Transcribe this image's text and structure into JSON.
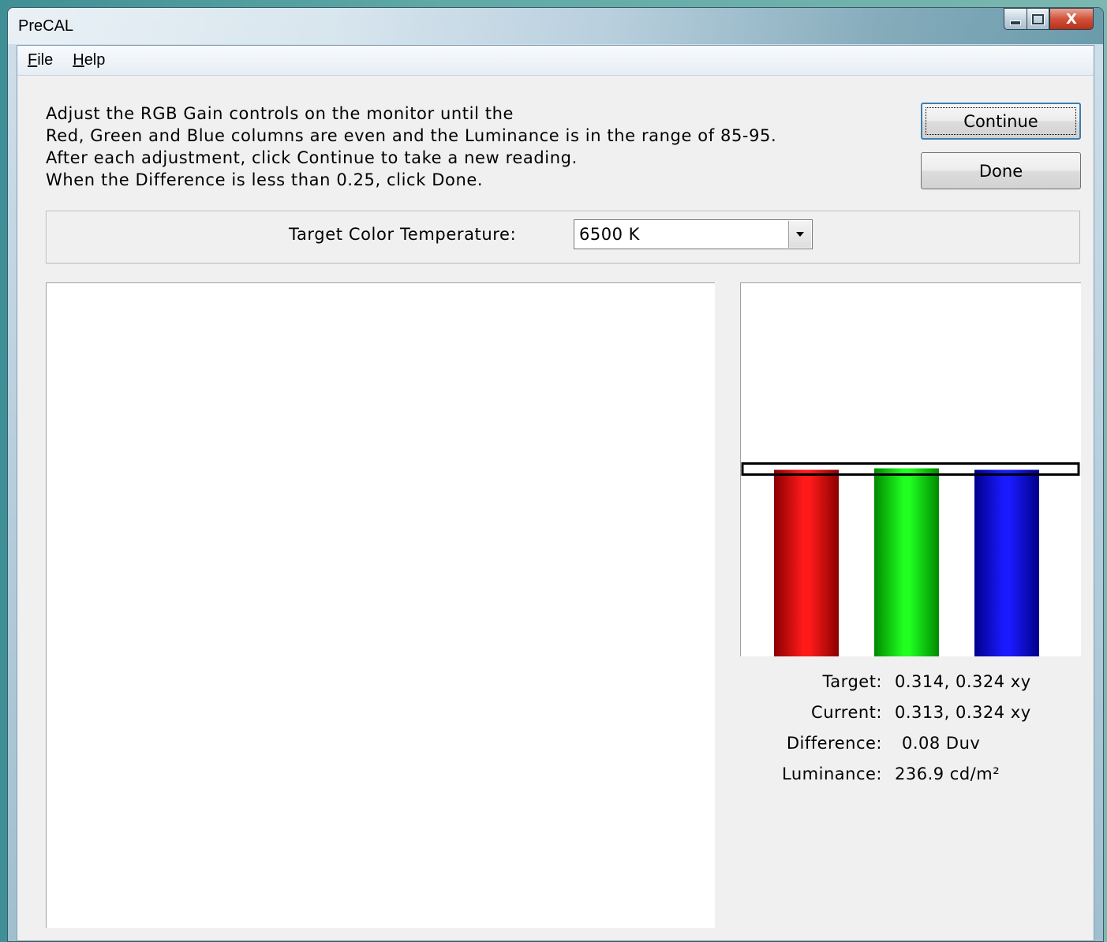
{
  "window": {
    "title": "PreCAL",
    "close_glyph": "X"
  },
  "menu": {
    "file": {
      "accel": "F",
      "rest": "ile"
    },
    "help": {
      "accel": "H",
      "rest": "elp"
    }
  },
  "instructions": [
    "Adjust the RGB Gain controls on the monitor until the",
    "Red, Green and Blue columns are even and the Luminance is in the range of 85-95.",
    "After each adjustment, click Continue to take a new reading.",
    "When the Difference is less than 0.25, click Done."
  ],
  "buttons": {
    "continue": "Continue",
    "done": "Done"
  },
  "target_temperature": {
    "label": "Target Color Temperature:",
    "selected": "6500 K"
  },
  "rgb_balance": {
    "target_level": 0.5,
    "bars": [
      {
        "name": "red",
        "level": 0.5,
        "color_dark": "#8a0000",
        "color_light": "#ff1a1a"
      },
      {
        "name": "green",
        "level": 0.504,
        "color_dark": "#008a00",
        "color_light": "#20ff20"
      },
      {
        "name": "blue",
        "level": 0.5,
        "color_dark": "#00008a",
        "color_light": "#1a1aff"
      }
    ]
  },
  "readouts": {
    "target": {
      "label": "Target:",
      "value": "0.314, 0.324 xy"
    },
    "current": {
      "label": "Current:",
      "value": "0.313, 0.324 xy"
    },
    "difference": {
      "label": "Difference:",
      "value": "0.08 Duv"
    },
    "luminance": {
      "label": "Luminance:",
      "value": "236.9 cd/m²"
    }
  },
  "colors": {
    "button_focus": "#3c7fb1",
    "panel_background": "#f0f0f0"
  }
}
